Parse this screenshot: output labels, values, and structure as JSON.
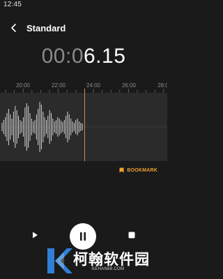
{
  "status_bar": {
    "time": "12:45"
  },
  "header": {
    "title": "Standard"
  },
  "timer": {
    "elapsed_part": "00:0",
    "current_part": "6.15"
  },
  "timeline": {
    "ticks": [
      "20:00",
      "22:00",
      "24:00",
      "26:00",
      "28:0"
    ]
  },
  "bookmark": {
    "label": "BOOKMARK"
  },
  "controls": {
    "play": "play-icon",
    "pause": "pause-icon",
    "stop": "stop-icon"
  },
  "watermark": {
    "title": "柯翰软件园",
    "url": "KEHAN88.COM"
  },
  "colors": {
    "accent": "#f0a030",
    "playhead": "#c98a5a",
    "waveform": "#d8d8d8",
    "watermark_blue": "#2f7fd6"
  }
}
